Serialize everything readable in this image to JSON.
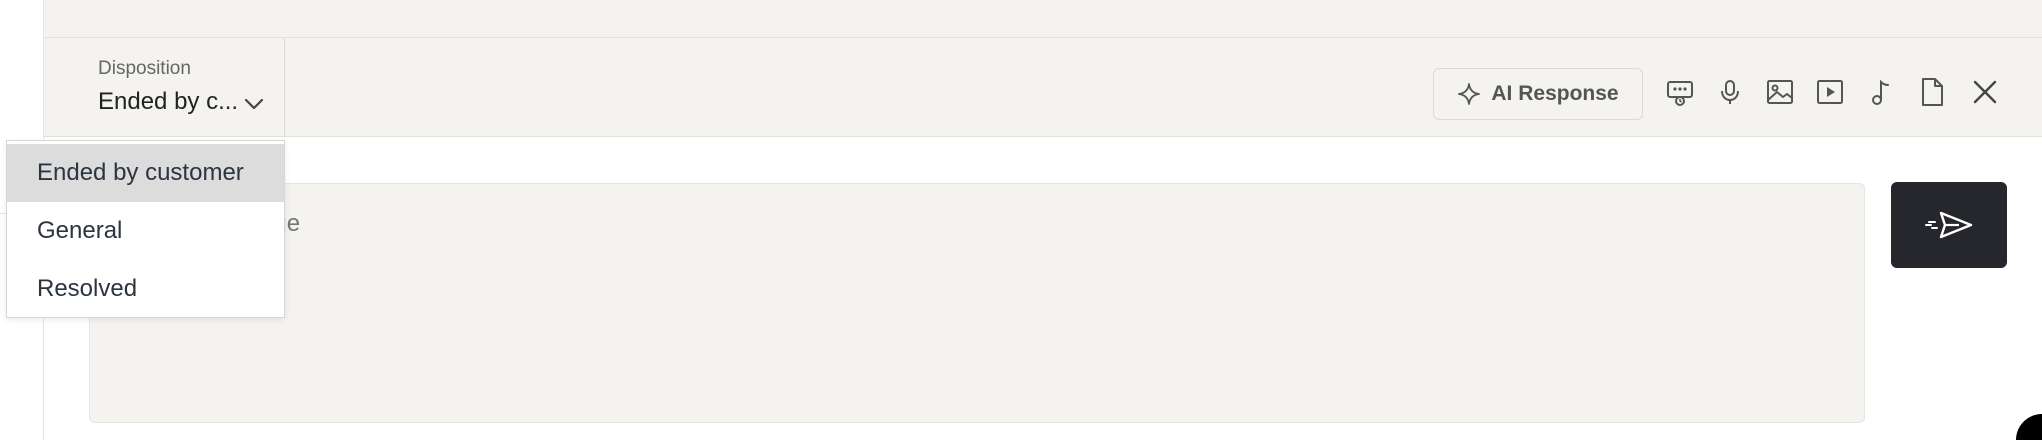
{
  "disposition": {
    "label": "Disposition",
    "value": "Ended by c..."
  },
  "dropdown": {
    "options": [
      "Ended by customer",
      "General",
      "Resolved"
    ],
    "selected_index": 0
  },
  "toolbar": {
    "ai_response_label": "AI Response",
    "icons": [
      "ai-sparkle-icon",
      "canned-response-icon",
      "microphone-icon",
      "image-icon",
      "video-icon",
      "music-note-icon",
      "file-icon",
      "close-icon"
    ]
  },
  "composer": {
    "placeholder": "Type a message",
    "visible_fragment": "e"
  },
  "colors": {
    "toolbar_bg": "#f4f3ef",
    "send_button_bg": "#25272c",
    "dropdown_selected_bg": "#dcdcdc"
  }
}
